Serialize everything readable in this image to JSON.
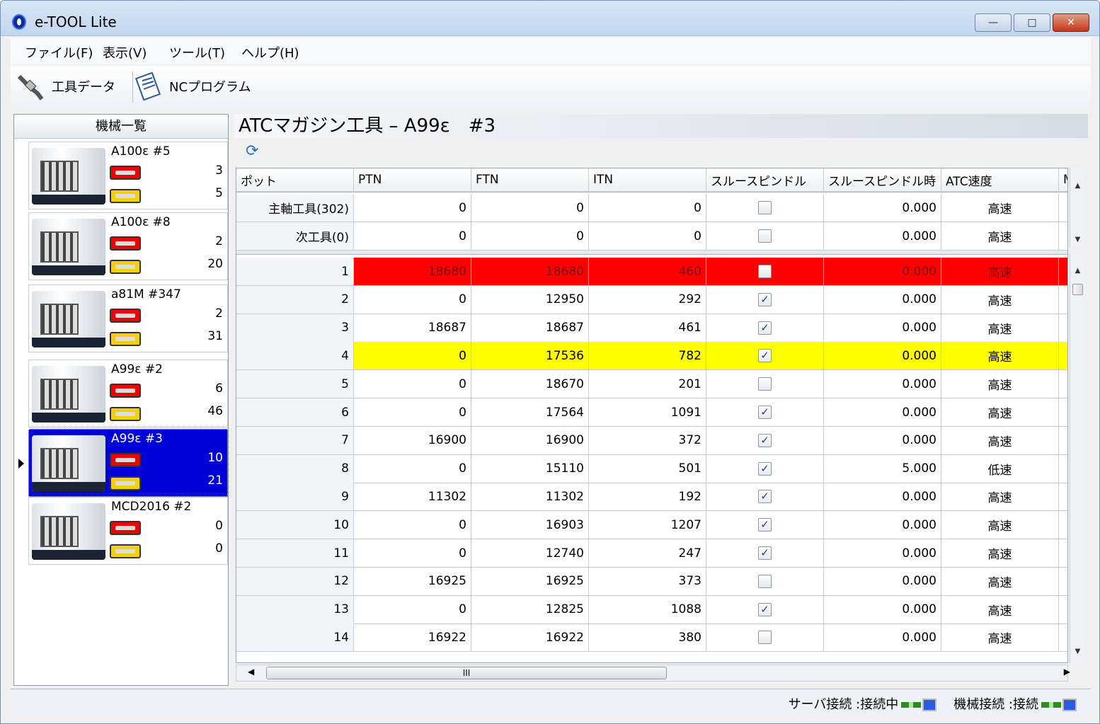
{
  "window": {
    "title": "e-TOOL Lite",
    "min": "—",
    "max": "□",
    "close": "✕"
  },
  "menu": [
    "ファイル(F)",
    "表示(V)",
    "ツール(T)",
    "ヘルプ(H)"
  ],
  "toolbar": {
    "tool_data": "工具データ",
    "nc_program": "NCプログラム"
  },
  "left": {
    "header": "機械一覧",
    "machines": [
      {
        "name": "A100ε #5",
        "red": "3",
        "yellow": "5"
      },
      {
        "name": "A100ε #8",
        "red": "2",
        "yellow": "20"
      },
      {
        "name": "a81M #347",
        "red": "2",
        "yellow": "31"
      },
      {
        "name": "A99ε #2",
        "red": "6",
        "yellow": "46"
      },
      {
        "name": "A99ε #3",
        "red": "10",
        "yellow": "21"
      },
      {
        "name": "MCD2016 #2",
        "red": "0",
        "yellow": "0"
      }
    ]
  },
  "main": {
    "title": "ATCマガジン工具 – A99ε　#3",
    "columns": [
      "ポット",
      "PTN",
      "FTN",
      "ITN",
      "スルースピンドル",
      "スルースピンドル時",
      "ATC速度",
      "M"
    ],
    "fixed_rows": [
      {
        "pot": "主軸工具(302)",
        "ptn": "0",
        "ftn": "0",
        "itn": "0",
        "through": false,
        "time": "0.000",
        "atc": "高速"
      },
      {
        "pot": "次工具(0)",
        "ptn": "0",
        "ftn": "0",
        "itn": "0",
        "through": false,
        "time": "0.000",
        "atc": "高速"
      }
    ],
    "rows": [
      {
        "pot": "1",
        "ptn": "18680",
        "ftn": "18680",
        "itn": "460",
        "through": false,
        "time": "0.000",
        "atc": "高速",
        "hl": "red"
      },
      {
        "pot": "2",
        "ptn": "0",
        "ftn": "12950",
        "itn": "292",
        "through": true,
        "time": "0.000",
        "atc": "高速"
      },
      {
        "pot": "3",
        "ptn": "18687",
        "ftn": "18687",
        "itn": "461",
        "through": true,
        "time": "0.000",
        "atc": "高速"
      },
      {
        "pot": "4",
        "ptn": "0",
        "ftn": "17536",
        "itn": "782",
        "through": true,
        "time": "0.000",
        "atc": "高速",
        "hl": "yel"
      },
      {
        "pot": "5",
        "ptn": "0",
        "ftn": "18670",
        "itn": "201",
        "through": false,
        "time": "0.000",
        "atc": "高速"
      },
      {
        "pot": "6",
        "ptn": "0",
        "ftn": "17564",
        "itn": "1091",
        "through": true,
        "time": "0.000",
        "atc": "高速"
      },
      {
        "pot": "7",
        "ptn": "16900",
        "ftn": "16900",
        "itn": "372",
        "through": true,
        "time": "0.000",
        "atc": "高速"
      },
      {
        "pot": "8",
        "ptn": "0",
        "ftn": "15110",
        "itn": "501",
        "through": true,
        "time": "5.000",
        "atc": "低速"
      },
      {
        "pot": "9",
        "ptn": "11302",
        "ftn": "11302",
        "itn": "192",
        "through": true,
        "time": "0.000",
        "atc": "高速"
      },
      {
        "pot": "10",
        "ptn": "0",
        "ftn": "16903",
        "itn": "1207",
        "through": true,
        "time": "0.000",
        "atc": "高速"
      },
      {
        "pot": "11",
        "ptn": "0",
        "ftn": "12740",
        "itn": "247",
        "through": true,
        "time": "0.000",
        "atc": "高速"
      },
      {
        "pot": "12",
        "ptn": "16925",
        "ftn": "16925",
        "itn": "373",
        "through": false,
        "time": "0.000",
        "atc": "高速"
      },
      {
        "pot": "13",
        "ptn": "0",
        "ftn": "12825",
        "itn": "1088",
        "through": true,
        "time": "0.000",
        "atc": "高速"
      },
      {
        "pot": "14",
        "ptn": "16922",
        "ftn": "16922",
        "itn": "380",
        "through": false,
        "time": "0.000",
        "atc": "高速"
      }
    ],
    "hscroll_thumb": "III"
  },
  "status": {
    "server": "サーバ接続 :接続中",
    "machine": "機械接続 :接続"
  },
  "colors": {
    "selected": "#0000d8",
    "red_row": "#ff0000",
    "yellow_row": "#ffff00"
  }
}
